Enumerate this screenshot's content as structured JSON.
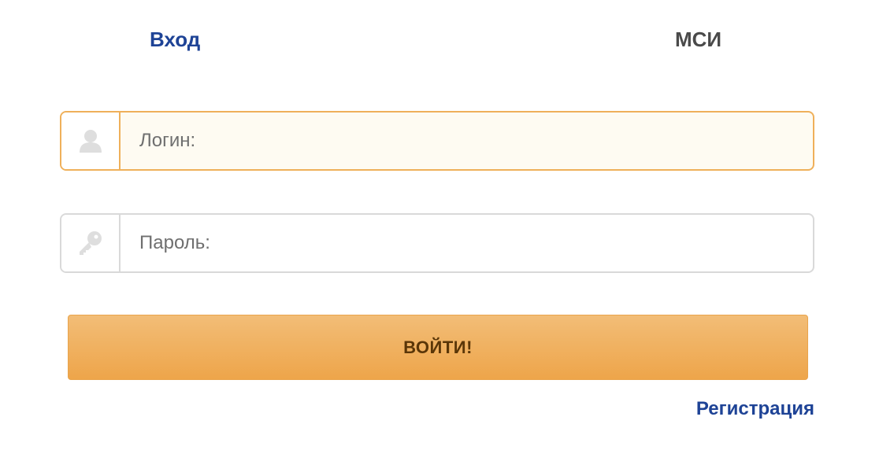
{
  "tabs": {
    "login": "Вход",
    "msi": "МСИ"
  },
  "login_field": {
    "placeholder": "Логин:",
    "value": "",
    "icon": "user-icon"
  },
  "password_field": {
    "placeholder": "Пароль:",
    "value": "",
    "icon": "key-icon"
  },
  "submit": {
    "label": "ВОЙТИ!"
  },
  "register": {
    "label": "Регистрация"
  },
  "colors": {
    "accent_blue": "#1e4396",
    "button_orange": "#eea54a",
    "focus_border": "#efb05a"
  }
}
